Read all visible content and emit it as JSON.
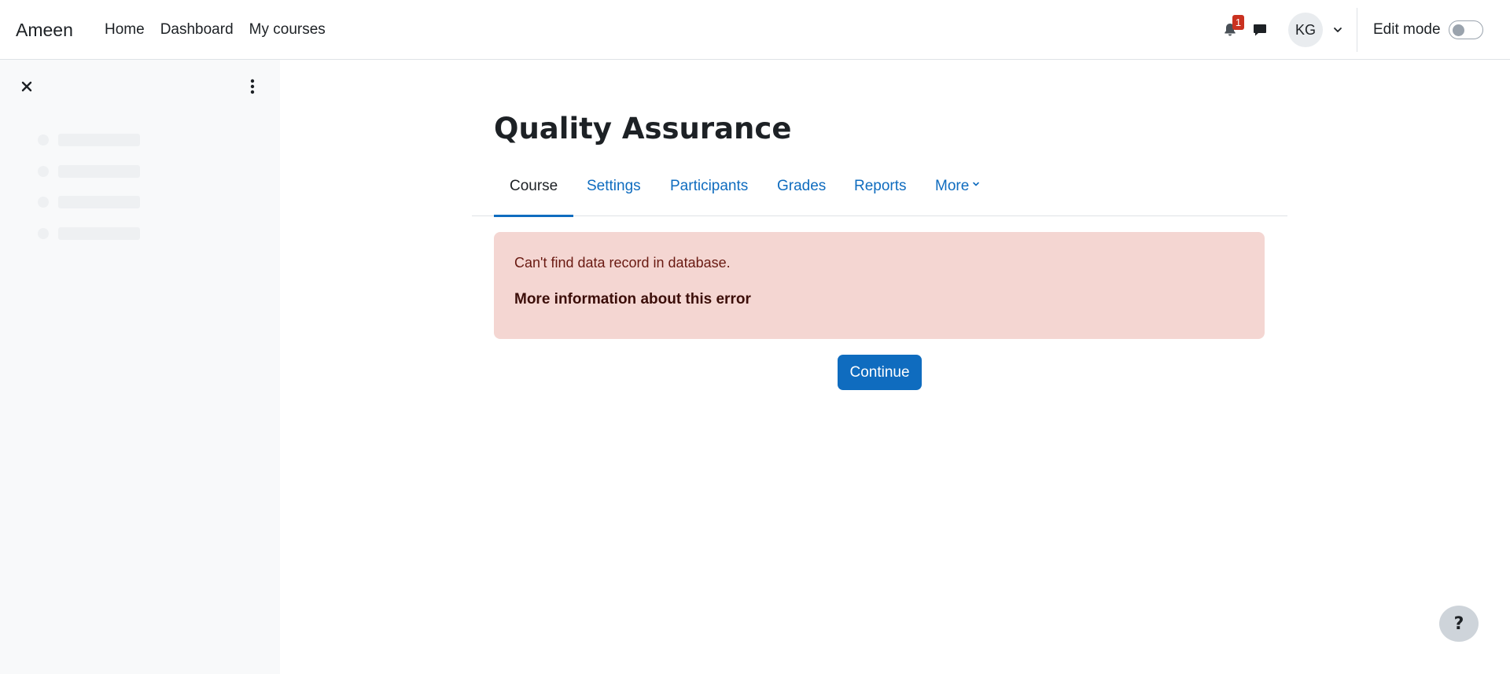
{
  "brand": "Ameen",
  "primary_nav": [
    {
      "label": "Home"
    },
    {
      "label": "Dashboard"
    },
    {
      "label": "My courses"
    }
  ],
  "notifications": {
    "count": "1",
    "icon": "bell-icon"
  },
  "messages": {
    "icon": "chat-icon"
  },
  "user": {
    "initials": "KG"
  },
  "edit_mode": {
    "label": "Edit mode",
    "enabled": false
  },
  "course": {
    "title": "Quality Assurance",
    "tabs": [
      {
        "label": "Course",
        "active": true
      },
      {
        "label": "Settings"
      },
      {
        "label": "Participants"
      },
      {
        "label": "Grades"
      },
      {
        "label": "Reports"
      },
      {
        "label": "More"
      }
    ]
  },
  "alert": {
    "message": "Can't find data record in database.",
    "more_info": "More information about this error"
  },
  "continue_label": "Continue",
  "help_label": "?",
  "colors": {
    "primary": "#0f6cbf",
    "alert_bg": "#f4d6d2",
    "alert_text": "#691911",
    "badge": "#ca3120",
    "drawer_bg": "#f8f9fa"
  }
}
